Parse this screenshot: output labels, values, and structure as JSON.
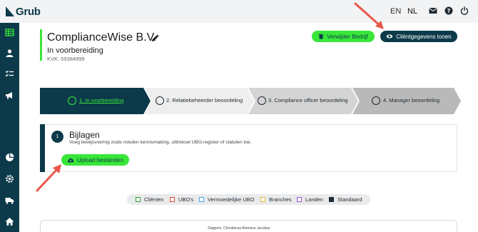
{
  "app": {
    "logo_text": "Grub"
  },
  "header": {
    "languages": [
      {
        "label": "EN",
        "active": false
      },
      {
        "label": "NL",
        "active": true
      }
    ],
    "icons": [
      "mail-icon",
      "help-icon",
      "power-icon"
    ]
  },
  "sidebar": {
    "icons": [
      "table-icon",
      "user-icon",
      "checklist-icon",
      "megaphone-icon",
      "pie-chart-icon",
      "settings-icon",
      "truck-icon",
      "home-icon"
    ]
  },
  "company": {
    "name": "ComplianceWise B.V.",
    "status": "In voorbereiding",
    "kvk": "KVK: 59384999"
  },
  "buttons": {
    "remove_company": "Verwijder Bedrijf",
    "show_client_data": "Cliëntgegevens tonen",
    "upload_files": "Upload bestanden"
  },
  "steps": [
    {
      "label": "1. In voorbereiding",
      "active": true
    },
    {
      "label": "2. Relatiebeheerder beoordeling",
      "active": false
    },
    {
      "label": "3. Compliance officer beoordeling",
      "active": false
    },
    {
      "label": "4. Manager beoordeling",
      "active": false
    }
  ],
  "attachments": {
    "number": "1",
    "title": "Bijlagen",
    "description": "Voeg bewijsvoering zoals notulen kennismaking, uittreksel UBO-register of statuten toe."
  },
  "legend": [
    {
      "label": "Cliënten",
      "color": "#2e9e2e",
      "checked": false
    },
    {
      "label": "UBO's",
      "color": "#e0453a",
      "checked": false
    },
    {
      "label": "Vermoedelijke UBO",
      "color": "#4aa3e0",
      "checked": false
    },
    {
      "label": "Branches",
      "color": "#e6b83a",
      "checked": false
    },
    {
      "label": "Landen",
      "color": "#9b59d0",
      "checked": false
    },
    {
      "label": "Standaard",
      "color": "#1f2a33",
      "checked": true
    }
  ],
  "document": {
    "person_name": "Dappers, Christianus Antonius Jacobus"
  },
  "colors": {
    "brand_dark": "#0d3a4a",
    "accent_green": "#39e639",
    "annotation_arrow": "#e8584a"
  }
}
